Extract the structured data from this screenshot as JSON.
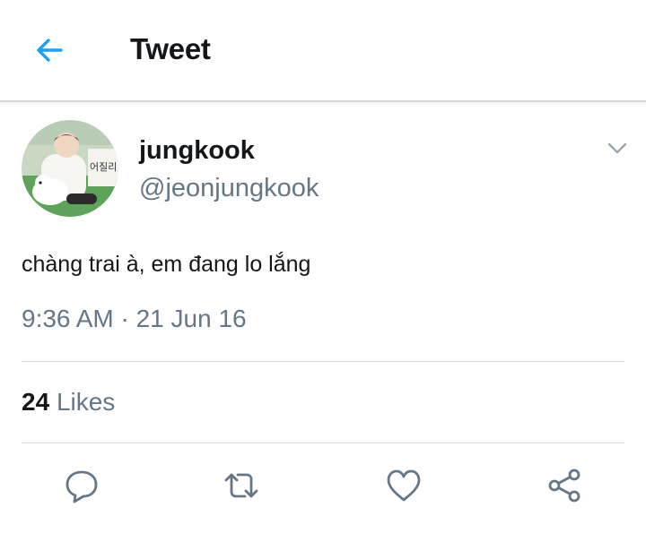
{
  "header": {
    "title": "Tweet",
    "back_icon": "arrow-left-icon",
    "accent_color": "#1da1f2"
  },
  "tweet": {
    "author": {
      "display_name": "jungkook",
      "handle": "@jeonjungkook",
      "avatar_sign_text": "어질리"
    },
    "menu_icon": "chevron-down-icon",
    "text": "chàng trai à, em đang lo lắng",
    "timestamp": "9:36 AM · 21 Jun 16",
    "likes": {
      "count": "24",
      "label": "Likes"
    }
  },
  "actions": [
    {
      "name": "reply",
      "icon": "speech-bubble-icon"
    },
    {
      "name": "retweet",
      "icon": "retweet-icon"
    },
    {
      "name": "like",
      "icon": "heart-icon"
    },
    {
      "name": "share",
      "icon": "share-icon"
    }
  ],
  "colors": {
    "primary_text": "#14171a",
    "secondary_text": "#657786",
    "icon_gray": "#657786",
    "divider": "#d8dde1"
  }
}
